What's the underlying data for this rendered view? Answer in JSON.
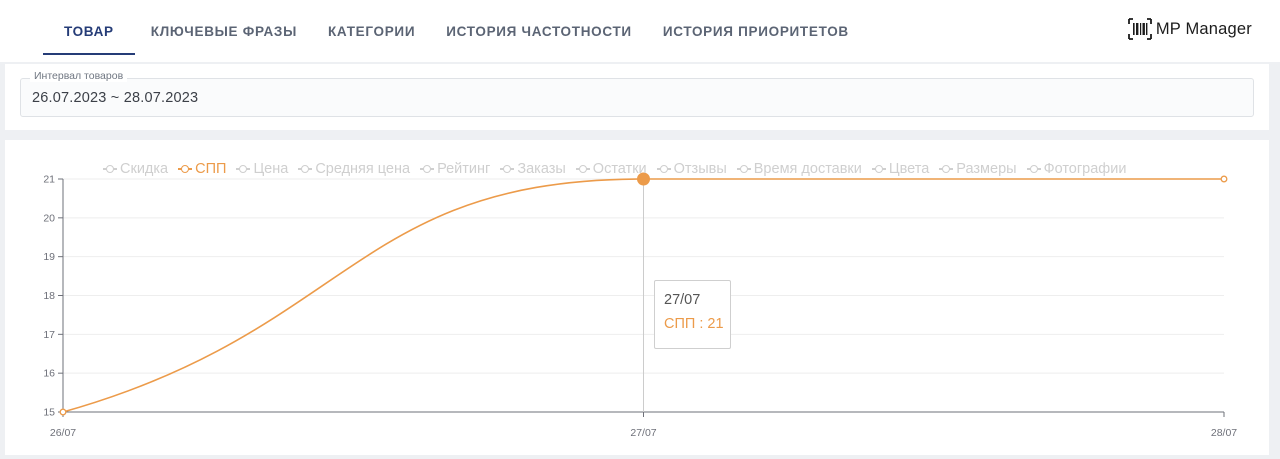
{
  "tabs": [
    {
      "label": "ТОВАР",
      "active": true
    },
    {
      "label": "КЛЮЧЕВЫЕ ФРАЗЫ",
      "active": false
    },
    {
      "label": "КАТЕГОРИИ",
      "active": false
    },
    {
      "label": "ИСТОРИЯ ЧАСТОТНОСТИ",
      "active": false
    },
    {
      "label": "ИСТОРИЯ ПРИОРИТЕТОВ",
      "active": false
    }
  ],
  "brand": {
    "name": "MP Manager",
    "icon": "barcode-icon"
  },
  "filter": {
    "label": "Интервал товаров",
    "value": "26.07.2023 ~ 28.07.2023"
  },
  "chart_data": {
    "type": "line",
    "categories": [
      "26/07",
      "27/07",
      "28/07"
    ],
    "series": [
      {
        "name": "СПП",
        "values": [
          15,
          21,
          21
        ],
        "active": true
      }
    ],
    "legend": [
      "Скидка",
      "СПП",
      "Цена",
      "Средняя цена",
      "Рейтинг",
      "Заказы",
      "Остатки",
      "Отзывы",
      "Время доставки",
      "Цвета",
      "Размеры",
      "Фотографии"
    ],
    "legend_active": "СПП",
    "legend_position": "top",
    "ylim": [
      15,
      21
    ],
    "yticks": [
      15,
      16,
      17,
      18,
      19,
      20,
      21
    ],
    "grid": true,
    "smooth": true,
    "colors": {
      "active": "#ec9b4a",
      "inactive": "#cfcfcf"
    }
  },
  "tooltip": {
    "title": "27/07",
    "series": "СПП",
    "value": "21",
    "text": "СПП : 21"
  }
}
